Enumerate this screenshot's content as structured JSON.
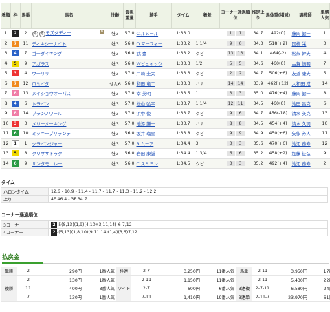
{
  "headers": [
    "着順",
    "枠",
    "馬番",
    "馬名",
    "性齢",
    "負担重量",
    "騎手",
    "タイム",
    "着差",
    "コーナー通過順位",
    "推定上り",
    "馬体重(増減)",
    "調教師",
    "単勝人気"
  ],
  "frame_colors": {
    "1": "#ffffff",
    "2": "#222222",
    "3": "#e33",
    "4": "#2a62c7",
    "5": "#f0d800",
    "6": "#2a9a45",
    "7": "#f08a1e",
    "8": "#f07ca6"
  },
  "frame_text_colors": {
    "1": "#222",
    "2": "#fff",
    "3": "#fff",
    "4": "#fff",
    "5": "#222",
    "6": "#fff",
    "7": "#fff",
    "8": "#fff"
  },
  "results": [
    {
      "rank": "1",
      "frame": "2",
      "num": "2",
      "marks": [
        "外",
        "地"
      ],
      "blinker": "B",
      "name": "モズダディー",
      "sexage": "牡3",
      "weight": "57.0",
      "jockey": "C.ルメール",
      "time": "1:33.0",
      "margin": "",
      "corner": [
        "1",
        "1"
      ],
      "last3f": "34.7",
      "body": "492(0)",
      "trainer": "藤岡 健一",
      "pop": "1"
    },
    {
      "rank": "2",
      "frame": "7",
      "num": "11",
      "marks": [],
      "blinker": "",
      "name": "ディキシーナイト",
      "sexage": "牡3",
      "weight": "56.0",
      "jockey": "O.マーフィー",
      "time": "1:33.2",
      "margin": "1 1/4",
      "corner": [
        "9",
        "6"
      ],
      "last3f": "34.3",
      "body": "518(+2)",
      "trainer": "国枝 栄",
      "pop": "3"
    },
    {
      "rank": "3",
      "frame": "4",
      "num": "7",
      "marks": [],
      "blinker": "",
      "name": "ゴーダイキング",
      "sexage": "牡3",
      "weight": "56.0",
      "jockey": "武 豊",
      "time": "1:33.2",
      "margin": "クビ",
      "corner": [
        "13",
        "13"
      ],
      "last3f": "34.1",
      "body": "464(-2)",
      "trainer": "松永 幹夫",
      "pop": "4"
    },
    {
      "rank": "4",
      "frame": "5",
      "num": "9",
      "marks": [],
      "blinker": "",
      "name": "アガラス",
      "sexage": "牡3",
      "weight": "56.0",
      "jockey": "Wビュイック",
      "time": "1:33.3",
      "margin": "1/2",
      "corner": [
        "5",
        "5"
      ],
      "last3f": "34.6",
      "body": "460(0)",
      "trainer": "古賀 慎明",
      "pop": "7"
    },
    {
      "rank": "5",
      "frame": "3",
      "num": "4",
      "marks": [],
      "blinker": "",
      "name": "ウーリリ",
      "sexage": "牡3",
      "weight": "57.0",
      "jockey": "戸崎 圭太",
      "time": "1:33.3",
      "margin": "クビ",
      "corner": [
        "2",
        "2"
      ],
      "last3f": "34.7",
      "body": "506(+6)",
      "trainer": "友道 康夫",
      "pop": "5"
    },
    {
      "rank": "6",
      "frame": "7",
      "num": "12",
      "marks": [],
      "blinker": "",
      "name": "ロミイタ",
      "sexage": "せん6",
      "weight": "56.0",
      "jockey": "和田 竜二",
      "time": "1:33.3",
      "margin": "ハナ",
      "corner": [
        "14",
        "14"
      ],
      "last3f": "33.9",
      "body": "462(+12)",
      "trainer": "大和田 成",
      "pop": "14"
    },
    {
      "rank": "7",
      "frame": "8",
      "num": "13",
      "marks": [],
      "blinker": "",
      "name": "メイショウオーパス",
      "sexage": "牡3",
      "weight": "57.0",
      "jockey": "幸 英明",
      "time": "1:33.5",
      "margin": "1",
      "corner": [
        "3",
        "3"
      ],
      "last3f": "35.0",
      "body": "476(+4)",
      "trainer": "藤岡 健一",
      "pop": "8"
    },
    {
      "rank": "8",
      "frame": "4",
      "num": "6",
      "marks": [],
      "blinker": "",
      "name": "トライン",
      "sexage": "牡3",
      "weight": "57.0",
      "jockey": "松山 弘平",
      "time": "1:33.7",
      "margin": "1 1/4",
      "corner": [
        "12",
        "11"
      ],
      "last3f": "34.5",
      "body": "460(0)",
      "trainer": "池田 昌克",
      "pop": "6"
    },
    {
      "rank": "9",
      "frame": "8",
      "num": "14",
      "marks": [],
      "blinker": "",
      "name": "ブランノワール",
      "sexage": "牡3",
      "weight": "57.0",
      "jockey": "浜中 俊",
      "time": "1:33.7",
      "margin": "クビ",
      "corner": [
        "9",
        "6"
      ],
      "last3f": "34.7",
      "body": "456(-18)",
      "trainer": "清水 英克",
      "pop": "13"
    },
    {
      "rank": "10",
      "frame": "3",
      "num": "3",
      "marks": [],
      "blinker": "",
      "name": "メリーメーキング",
      "sexage": "牡3",
      "weight": "57.0",
      "jockey": "池添 謙一",
      "time": "1:33.7",
      "margin": "ハナ",
      "corner": [
        "8",
        "8"
      ],
      "last3f": "34.5",
      "body": "454(+4)",
      "trainer": "清水 久詞",
      "pop": "10"
    },
    {
      "rank": "11",
      "frame": "6",
      "num": "10",
      "marks": [],
      "blinker": "",
      "name": "ミッキーブリランテ",
      "sexage": "牡3",
      "weight": "56.0",
      "jockey": "坂井 瑠星",
      "time": "1:33.8",
      "margin": "クビ",
      "corner": [
        "9",
        "9"
      ],
      "last3f": "34.9",
      "body": "450(+6)",
      "trainer": "矢作 芳人",
      "pop": "11"
    },
    {
      "rank": "12",
      "frame": "1",
      "num": "1",
      "marks": [],
      "blinker": "",
      "name": "クラインジャー",
      "sexage": "牡3",
      "weight": "57.0",
      "jockey": "R.ムーア",
      "time": "1:34.4",
      "margin": "3",
      "corner": [
        "3",
        "3"
      ],
      "last3f": "35.6",
      "body": "470(+6)",
      "trainer": "池江 泰寿",
      "pop": "12"
    },
    {
      "rank": "13",
      "frame": "5",
      "num": "8",
      "marks": [],
      "blinker": "",
      "name": "クリザサトゥク",
      "sexage": "牡3",
      "weight": "56.0",
      "jockey": "岩田 康誠",
      "time": "1:34.4",
      "margin": "1 3/4",
      "corner": [
        "6",
        "6"
      ],
      "last3f": "35.2",
      "body": "458(+2)",
      "trainer": "加藤 征弘",
      "pop": "9"
    },
    {
      "rank": "14",
      "frame": "6",
      "num": "9",
      "marks": [],
      "blinker": "",
      "name": "サンタモニレー",
      "sexage": "牡3",
      "weight": "56.0",
      "jockey": "C.スミヨン",
      "time": "1:34.5",
      "margin": "クビ",
      "corner": [
        "3",
        "3"
      ],
      "last3f": "35.2",
      "body": "492(+4)",
      "trainer": "池江 泰寿",
      "pop": "2"
    }
  ],
  "time_section": {
    "title": "タイム",
    "rows": [
      {
        "label": "ハロンタイム",
        "value": "12.6 - 10.9 - 11.4 - 11.7 - 11.7 - 11.3 - 11.2 - 12.2"
      },
      {
        "label": "上り",
        "value": "4F 46.4 - 3F 34.7"
      }
    ]
  },
  "corner_section": {
    "title": "コーナー通過順位",
    "rows": [
      {
        "label": "3コーナー",
        "lead": "2",
        "value": "-5(8,13)(1,9)(4,10)(3,11,14)-6-7,12"
      },
      {
        "label": "4コーナー",
        "lead": "2",
        "value": "-(5,13)(1,8,10)(9,11,14)(1,4)(3,6)7,12"
      }
    ]
  },
  "payout_title": "払戻金",
  "payouts": [
    [
      {
        "type": "単勝",
        "horse": "2",
        "amount": "290円",
        "pop": "1番人気"
      },
      {
        "type": "枠連",
        "horse": "2-7",
        "amount": "3,250円",
        "pop": "11番人気"
      },
      {
        "type": "馬単",
        "horse": "2-11",
        "amount": "3,950円",
        "pop": "17番人気"
      }
    ],
    [
      {
        "type": "",
        "horse": "2",
        "amount": "130円",
        "pop": "1番人気"
      },
      {
        "type": "",
        "horse": "2-11",
        "amount": "1,150円",
        "pop": "11番人気"
      },
      {
        "type": "",
        "horse": "2-11",
        "amount": "5,430円",
        "pop": "22番人気"
      }
    ],
    [
      {
        "type": "複勝",
        "horse": "11",
        "amount": "400円",
        "pop": "8番人気"
      },
      {
        "type": "ワイド",
        "horse": "2-7",
        "amount": "600円",
        "pop": "6番人気"
      },
      {
        "type": "3連複",
        "horse": "2-7-11",
        "amount": "6,580円",
        "pop": "24番人気"
      }
    ],
    [
      {
        "type": "",
        "horse": "7",
        "amount": "130円",
        "pop": "1番人気"
      },
      {
        "type": "",
        "horse": "7-11",
        "amount": "1,410円",
        "pop": "19番人気"
      },
      {
        "type": "3連単",
        "horse": "2-11-7",
        "amount": "23,970円",
        "pop": "61番人気"
      }
    ]
  ]
}
